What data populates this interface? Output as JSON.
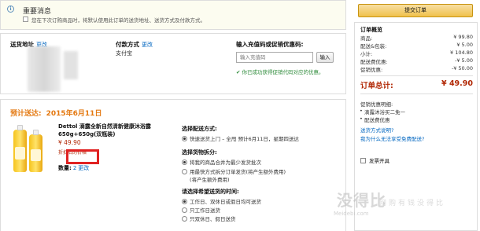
{
  "notice": {
    "title": "重要消息",
    "checkbox_label": "您在下次订购商品时，将默认使用此订单的送货地址、送货方式及付款方式。"
  },
  "address": {
    "label": "送货地址",
    "change": "更改"
  },
  "payment": {
    "label": "付款方式",
    "change": "更改",
    "value": "支付宝"
  },
  "promo": {
    "label": "输入充值码或促销优惠码:",
    "placeholder": "输入充值码",
    "button": "输入",
    "success": "✔ 你已成功获得促销代码对应的优惠。"
  },
  "shipment": {
    "label": "预计送达:",
    "date": "2015年6月11日"
  },
  "product": {
    "name": "Dettol 滴露全新自然清新健康沐浴露 650g+650g(双瓶装)",
    "price": "¥ 49.90",
    "note_prefix": "",
    "note_highlight": "折扣后的价格",
    "qty_label": "数量:",
    "qty": "2",
    "qty_change": "更改"
  },
  "delivery": {
    "heading": "选择配送方式:",
    "option": "快速送货上门 – 全甩 预计6月11日，星期四送达"
  },
  "grouping": {
    "heading": "选择货物拆分:",
    "option1": "将我的商品合并为最少发货批次",
    "option2": "用最快方式拆分订单发货(将产生额外费用)",
    "option2_note": "(将产生额外费用)"
  },
  "time": {
    "heading": "请选择希望送货的时间:",
    "option1": "工作日、双休日或假日均可送货",
    "option2": "只工作日送货",
    "option3": "只双休日、假日送货"
  },
  "sidebar": {
    "submit": "提交订单",
    "summary_title": "订单概览",
    "rows": [
      {
        "label": "商品:",
        "value": "¥ 99.80"
      },
      {
        "label": "配送&包装:",
        "value": "¥ 5.00"
      },
      {
        "label": "小计:",
        "value": "¥ 104.80"
      },
      {
        "label": "配送费优惠:",
        "value": "-¥ 5.00"
      },
      {
        "label": "促销优惠:",
        "value": "-¥ 50.00"
      }
    ],
    "total_label": "订单总计:",
    "total_value": "¥ 49.90",
    "promo_heading": "促销优惠明细:",
    "promo_items": [
      "滴露沐浴买二免一",
      "配送费优惠"
    ],
    "link1": "送货方式说明?",
    "link2": "我为什么无法享受免费配送?",
    "gift_label": "发票开具"
  },
  "watermark": {
    "text": "没得比",
    "url": "Meidebi.com",
    "slogan": "网购有钱没得比"
  }
}
